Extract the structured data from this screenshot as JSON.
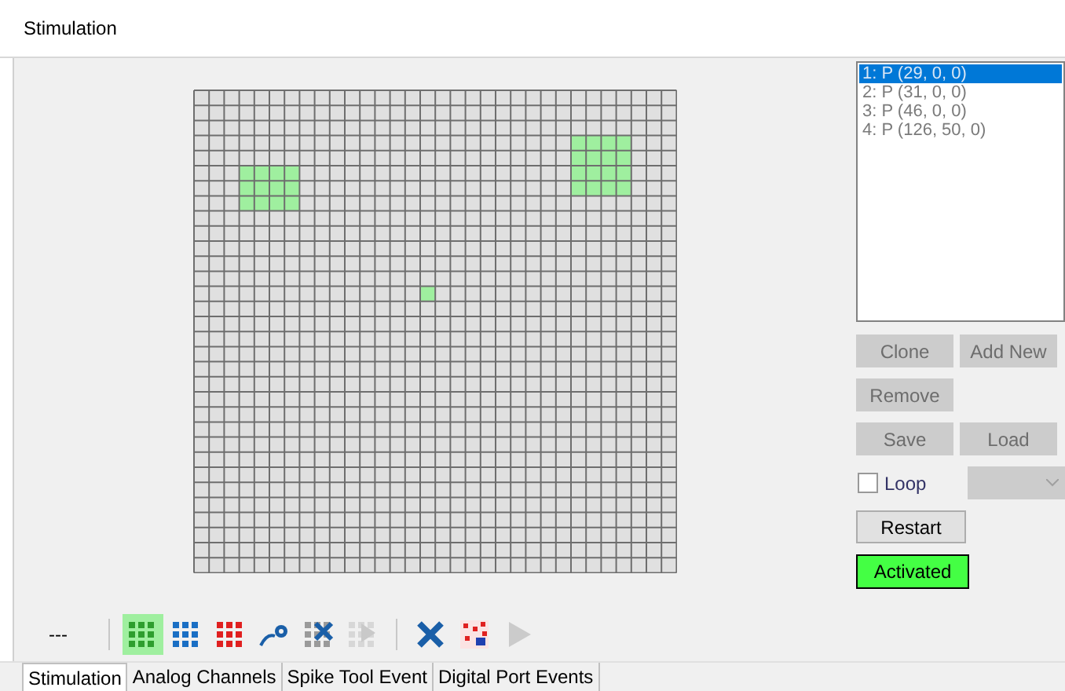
{
  "window": {
    "title": "Stimulation"
  },
  "patterns": [
    {
      "label": "1: P (29, 0, 0)",
      "selected": true
    },
    {
      "label": "2: P (31, 0, 0)",
      "selected": false
    },
    {
      "label": "3: P (46, 0, 0)",
      "selected": false
    },
    {
      "label": "4: P (126, 50, 0)",
      "selected": false
    }
  ],
  "buttons": [
    {
      "label": "Clone",
      "disabled": true
    },
    {
      "label": "Add New",
      "disabled": true
    },
    {
      "label": "Remove",
      "disabled": true
    },
    {
      "label": "Save",
      "disabled": true
    },
    {
      "label": "Load",
      "disabled": true
    }
  ],
  "loop": {
    "label": "Loop",
    "checked": false
  },
  "loop_select": {
    "disabled": true
  },
  "restart": {
    "label": "Restart"
  },
  "activated": {
    "label": "Activated",
    "on": true
  },
  "status": "---",
  "toolbar": [
    {
      "kind": "grid",
      "color": "#2e9e2e",
      "selected": true,
      "disabled": false
    },
    {
      "kind": "grid",
      "color": "#1a6fc4",
      "selected": false,
      "disabled": false
    },
    {
      "kind": "grid",
      "color": "#e02020",
      "selected": false,
      "disabled": false
    },
    {
      "kind": "wand",
      "selected": false,
      "disabled": false
    },
    {
      "kind": "gridx",
      "selected": false,
      "disabled": false
    },
    {
      "kind": "gridplay",
      "selected": false,
      "disabled": true
    },
    {
      "kind": "sep"
    },
    {
      "kind": "cross",
      "selected": false,
      "disabled": false
    },
    {
      "kind": "noise",
      "selected": false,
      "disabled": false
    },
    {
      "kind": "play",
      "selected": false,
      "disabled": true
    }
  ],
  "tabs": [
    {
      "label": "Stimulation",
      "selected": true
    },
    {
      "label": "Analog Channels",
      "selected": false
    },
    {
      "label": "Spike Tool Event",
      "selected": false
    },
    {
      "label": "Digital Port Events",
      "selected": false
    }
  ]
}
